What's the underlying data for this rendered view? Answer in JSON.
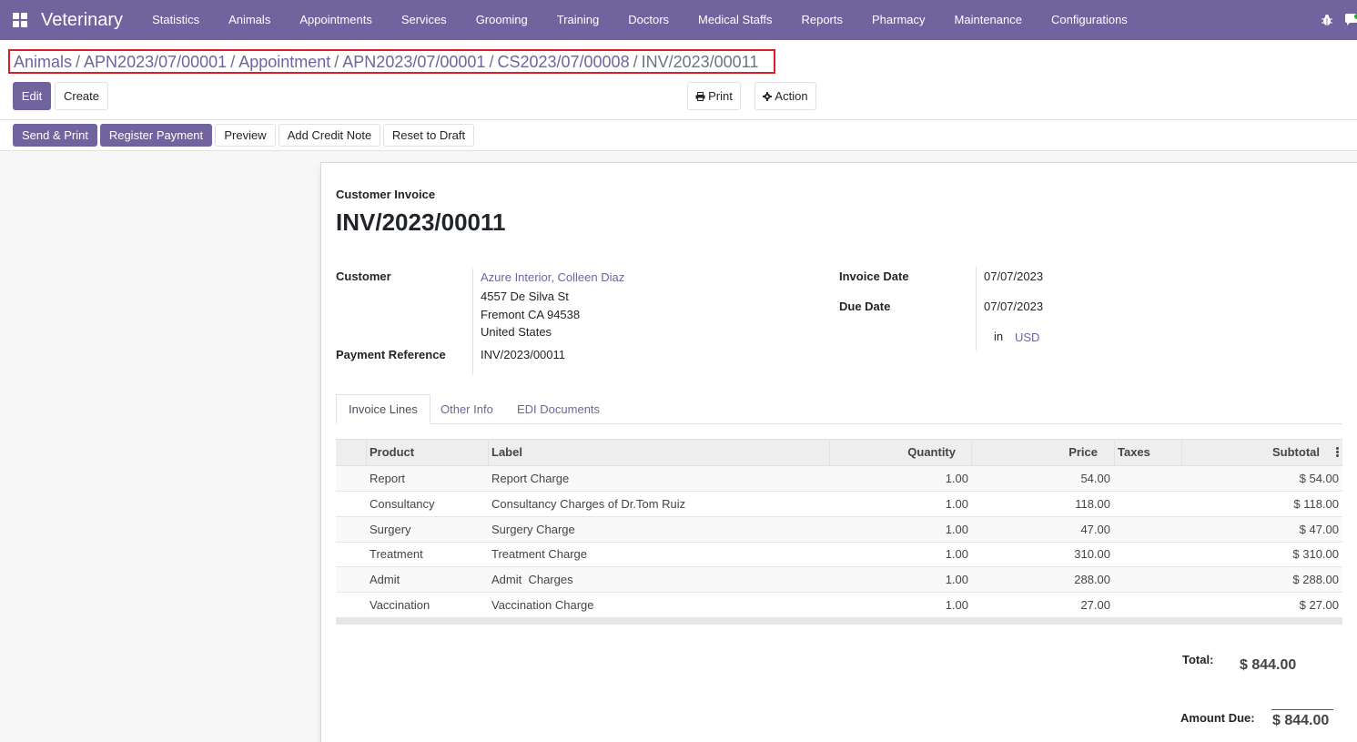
{
  "navbar": {
    "brand": "Veterinary",
    "menu": [
      "Statistics",
      "Animals",
      "Appointments",
      "Services",
      "Grooming",
      "Training",
      "Doctors",
      "Medical Staffs",
      "Reports",
      "Pharmacy",
      "Maintenance",
      "Configurations"
    ],
    "icons": [
      "apps-grid-icon",
      "bug-icon",
      "chat-icon"
    ],
    "color": "#71639e"
  },
  "breadcrumb": {
    "items": [
      "Animals",
      "APN2023/07/00001",
      "Appointment",
      "APN2023/07/00001",
      "CS2023/07/00008"
    ],
    "current": "INV/2023/00011",
    "separator": "/"
  },
  "controls": {
    "edit": "Edit",
    "create": "Create",
    "print": "Print",
    "action": "Action"
  },
  "statusbar": {
    "send_print": "Send & Print",
    "register_payment": "Register Payment",
    "preview": "Preview",
    "add_credit_note": "Add Credit Note",
    "reset_to_draft": "Reset to Draft"
  },
  "invoice": {
    "type": "Customer Invoice",
    "number": "INV/2023/00011",
    "customer_label": "Customer",
    "customer_name": "Azure Interior, Colleen Diaz",
    "address": [
      "4557 De Silva St",
      "Fremont CA 94538",
      "United States"
    ],
    "payment_ref_label": "Payment Reference",
    "payment_ref": "INV/2023/00011",
    "invoice_date_label": "Invoice Date",
    "invoice_date": "07/07/2023",
    "due_date_label": "Due Date",
    "due_date": "07/07/2023",
    "currency_in": "in",
    "currency": "USD"
  },
  "tabs": [
    "Invoice Lines",
    "Other Info",
    "EDI Documents"
  ],
  "table": {
    "headers": {
      "product": "Product",
      "label": "Label",
      "quantity": "Quantity",
      "price": "Price",
      "taxes": "Taxes",
      "subtotal": "Subtotal"
    },
    "rows": [
      {
        "product": "Report",
        "label": "Report Charge",
        "quantity": "1.00",
        "price": "54.00",
        "taxes": "",
        "subtotal": "$ 54.00"
      },
      {
        "product": "Consultancy",
        "label": "Consultancy Charges of Dr.Tom Ruiz",
        "quantity": "1.00",
        "price": "118.00",
        "taxes": "",
        "subtotal": "$ 118.00"
      },
      {
        "product": "Surgery",
        "label": "Surgery Charge",
        "quantity": "1.00",
        "price": "47.00",
        "taxes": "",
        "subtotal": "$ 47.00"
      },
      {
        "product": "Treatment",
        "label": "Treatment Charge",
        "quantity": "1.00",
        "price": "310.00",
        "taxes": "",
        "subtotal": "$ 310.00"
      },
      {
        "product": "Admit",
        "label": "Admit  Charges",
        "quantity": "1.00",
        "price": "288.00",
        "taxes": "",
        "subtotal": "$ 288.00"
      },
      {
        "product": "Vaccination",
        "label": "Vaccination Charge",
        "quantity": "1.00",
        "price": "27.00",
        "taxes": "",
        "subtotal": "$ 27.00"
      }
    ]
  },
  "totals": {
    "total_label": "Total:",
    "total": "$ 844.00",
    "amount_due_label": "Amount Due:",
    "amount_due": "$ 844.00"
  }
}
